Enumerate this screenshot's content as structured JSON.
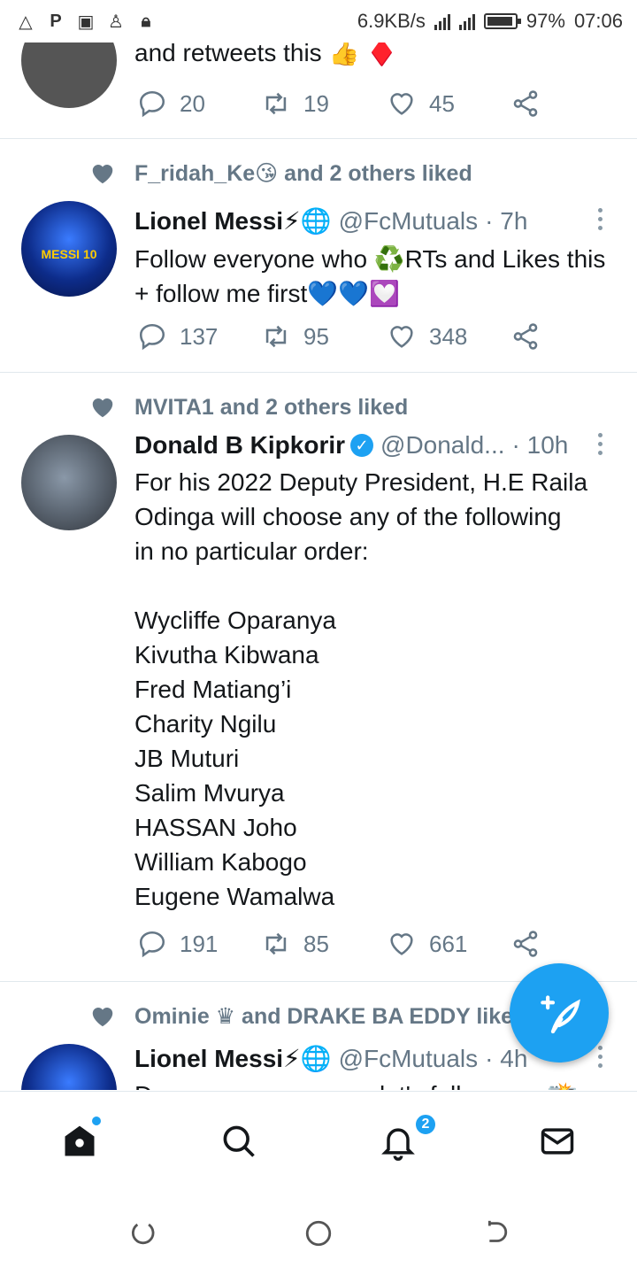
{
  "status_bar": {
    "speed": "6.9KB/s",
    "battery": "97%",
    "time": "07:06",
    "left_icons": [
      "triangle-icon",
      "parking-icon",
      "lock-app-icon",
      "tshirt-icon",
      "lock-icon"
    ]
  },
  "tweets": [
    {
      "body": "and retweets this 👍 ♦️",
      "replies": "20",
      "retweets": "19",
      "likes": "45"
    },
    {
      "social": "F_ridah_Ke😘 and 2 others liked",
      "name": "Lionel Messi⚡🌐",
      "handle": "@FcMutuals",
      "time": "· 7h",
      "body": "Follow everyone who ♻️RTs and Likes this + follow me first💙💙💟",
      "replies": "137",
      "retweets": "95",
      "likes": "348",
      "avatar_text": "MESSI 10"
    },
    {
      "social": "MVITA1 and 2 others liked",
      "name": "Donald B Kipkorir",
      "handle": "@Donald...",
      "time": "· 10h",
      "body": "For his 2022 Deputy President, H.E Raila\nOdinga will choose any of the following\nin no particular order:\n\nWycliffe Oparanya\nKivutha Kibwana\nFred Matiang’i\nCharity Ngilu\nJB Muturi\nSalim Mvurya\nHASSAN Joho\nWilliam Kabogo\nEugene Wamalwa",
      "replies": "191",
      "retweets": "85",
      "likes": "661"
    },
    {
      "social": "Ominie ♛ and DRAKE BA EDDY liked",
      "name": "Lionel Messi⚡🌐",
      "handle": "@FcMutuals",
      "time": "· 4h",
      "body": "Drop your usernames let's follow you 📸"
    }
  ],
  "bottom_nav": {
    "notifications_badge": "2"
  },
  "colors": {
    "accent": "#1da1f2",
    "muted": "#657786",
    "text": "#14171a",
    "divider": "#e1e8ed"
  }
}
